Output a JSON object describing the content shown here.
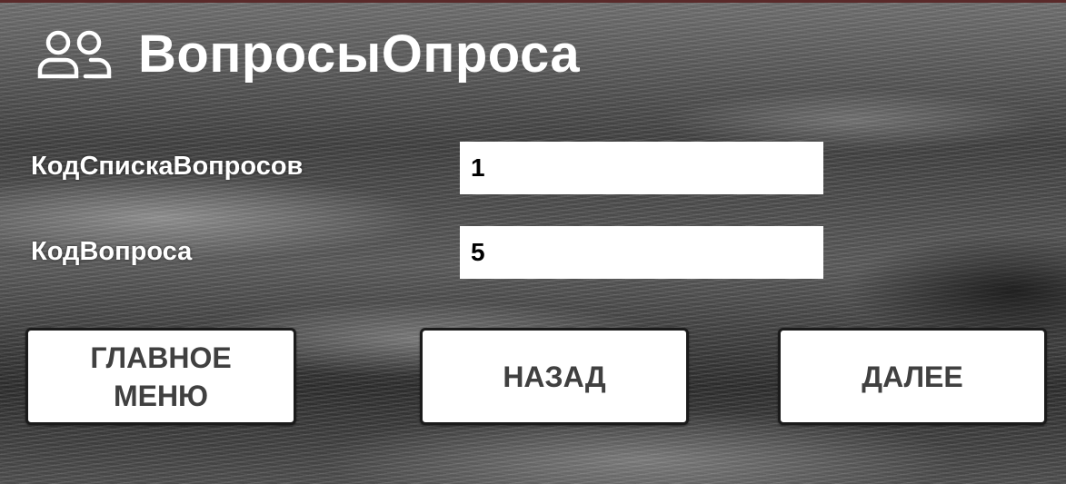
{
  "form": {
    "title": "ВопросыОпроса",
    "icon": "users-icon"
  },
  "fields": [
    {
      "label": "КодСпискаВопросов",
      "value": "1"
    },
    {
      "label": "КодВопроса",
      "value": "5"
    }
  ],
  "buttons": {
    "main_menu_line1": "ГЛАВНОЕ",
    "main_menu_line2": "МЕНЮ",
    "back": "НАЗАД",
    "next": "ДАЛЕЕ"
  },
  "colors": {
    "text_light": "#ffffff",
    "button_text": "#404040",
    "button_bg": "#ffffff"
  }
}
